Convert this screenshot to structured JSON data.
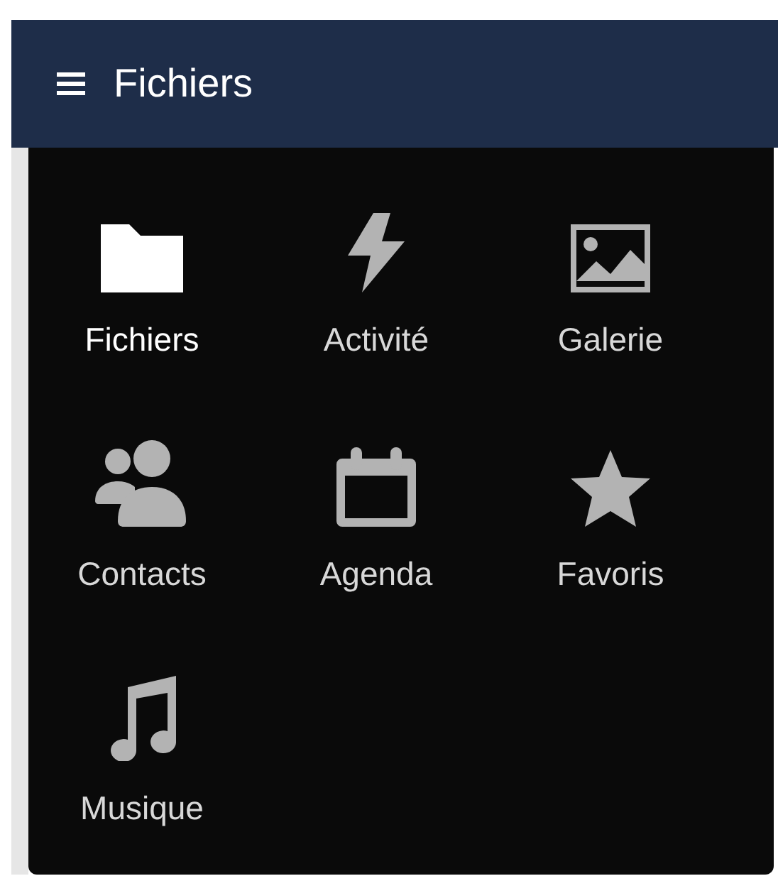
{
  "header": {
    "title": "Fichiers"
  },
  "apps": [
    {
      "label": "Fichiers",
      "kind": "folder",
      "selected": true
    },
    {
      "label": "Activité",
      "kind": "bolt",
      "selected": false
    },
    {
      "label": "Galerie",
      "kind": "image",
      "selected": false
    },
    {
      "label": "Contacts",
      "kind": "people",
      "selected": false
    },
    {
      "label": "Agenda",
      "kind": "calendar",
      "selected": false
    },
    {
      "label": "Favoris",
      "kind": "star",
      "selected": false
    },
    {
      "label": "Musique",
      "kind": "music",
      "selected": false
    }
  ]
}
